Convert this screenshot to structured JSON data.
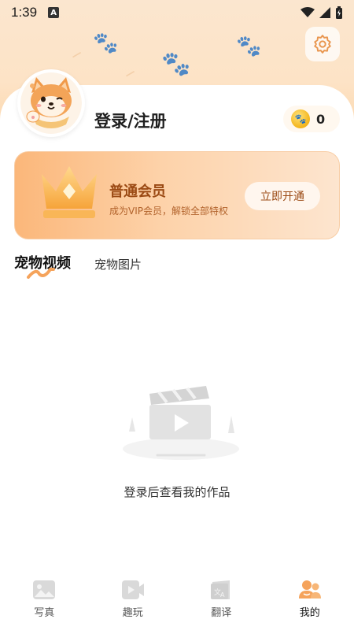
{
  "status_bar": {
    "time": "1:39",
    "badge": "A"
  },
  "profile": {
    "login_label": "登录/注册",
    "coin_count": "0"
  },
  "vip": {
    "title": "普通会员",
    "subtitle": "成为VIP会员，解锁全部特权",
    "button_label": "立即开通"
  },
  "tabs": [
    {
      "label": "宠物视频",
      "active": true
    },
    {
      "label": "宠物图片",
      "active": false
    }
  ],
  "empty_state": {
    "message": "登录后查看我的作品"
  },
  "bottom_nav": [
    {
      "label": "写真",
      "icon": "photo-icon"
    },
    {
      "label": "趣玩",
      "icon": "play-video-icon"
    },
    {
      "label": "翻译",
      "icon": "translate-icon"
    },
    {
      "label": "我的",
      "icon": "profile-icon",
      "active": true
    }
  ],
  "colors": {
    "accent": "#f5a35b",
    "vip_text": "#9b4a14",
    "hero_bg": "#fbe6cf"
  }
}
